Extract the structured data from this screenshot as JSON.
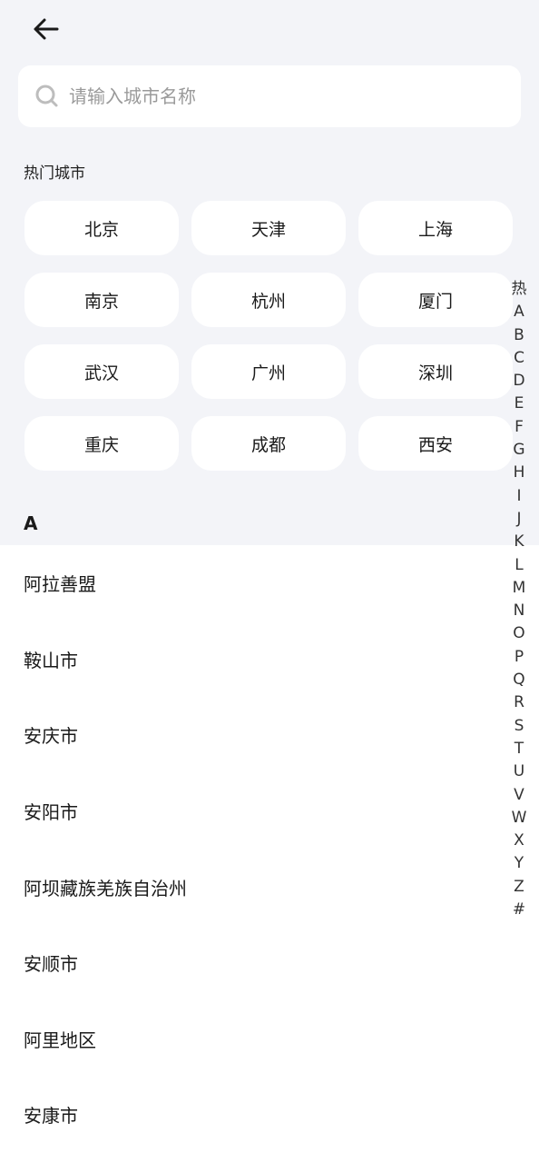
{
  "header": {
    "back_icon": "arrow-left-icon"
  },
  "search": {
    "placeholder": "请输入城市名称",
    "value": "",
    "icon": "search-icon"
  },
  "hot": {
    "title": "热门城市",
    "cities": [
      "北京",
      "天津",
      "上海",
      "南京",
      "杭州",
      "厦门",
      "武汉",
      "广州",
      "深圳",
      "重庆",
      "成都",
      "西安"
    ]
  },
  "sections": [
    {
      "letter": "A",
      "cities": [
        "阿拉善盟",
        "鞍山市",
        "安庆市",
        "安阳市",
        "阿坝藏族羌族自治州",
        "安顺市",
        "阿里地区",
        "安康市"
      ]
    }
  ],
  "index_bar": [
    "热",
    "A",
    "B",
    "C",
    "D",
    "E",
    "F",
    "G",
    "H",
    "I",
    "J",
    "K",
    "L",
    "M",
    "N",
    "O",
    "P",
    "Q",
    "R",
    "S",
    "T",
    "U",
    "V",
    "W",
    "X",
    "Y",
    "Z",
    "#"
  ],
  "colors": {
    "background_top": "#f3f4f8",
    "card": "#ffffff",
    "text": "#1a1a1a",
    "placeholder": "#9a9a9a"
  }
}
